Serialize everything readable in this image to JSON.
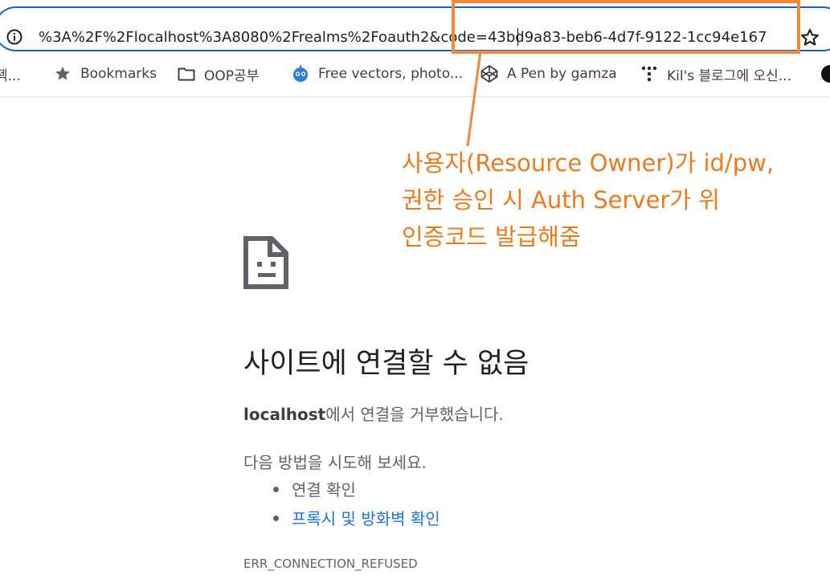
{
  "browser": {
    "url": "%3A%2F%2Flocalhost%3A8080%2Frealms%2Foauth2&code=43bd9a83-beb6-4d7f-9122-1cc94e167",
    "bookmarks": [
      {
        "label": "젝...",
        "icon": "cut-off-icon"
      },
      {
        "label": "Bookmarks",
        "icon": "star-icon"
      },
      {
        "label": "OOP공부",
        "icon": "folder-icon"
      },
      {
        "label": "Free vectors, photo...",
        "icon": "robot-face-icon"
      },
      {
        "label": "A Pen by gamza",
        "icon": "codepen-icon"
      },
      {
        "label": "Kil's 블로그에 오신...",
        "icon": "tistory-icon"
      }
    ]
  },
  "error": {
    "title": "사이트에 연결할 수 없음",
    "host": "localhost",
    "description_suffix": "에서 연결을 거부했습니다.",
    "try_text": "다음 방법을 시도해 보세요.",
    "suggestions": [
      "연결 확인",
      "프록시 및 방화벽 확인"
    ],
    "code": "ERR_CONNECTION_REFUSED"
  },
  "annotation": {
    "lines": [
      "사용자(Resource Owner)가 id/pw,",
      "권한 승인 시 Auth Server가 위",
      "인증코드 발급해줌"
    ],
    "color": "#f08a3a"
  }
}
